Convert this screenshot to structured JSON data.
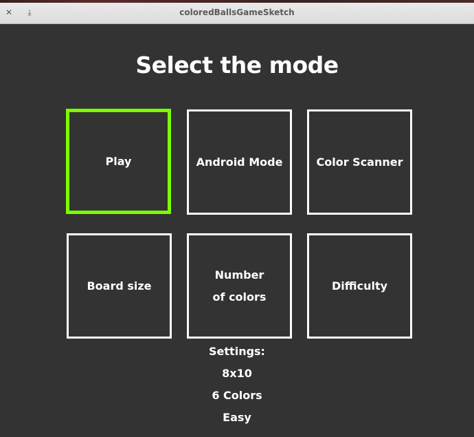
{
  "window": {
    "title": "coloredBallsGameSketch",
    "close_icon": "close-icon",
    "download_icon": "download-icon"
  },
  "heading": "Select the mode",
  "tiles": [
    {
      "label": "Play",
      "selected": true
    },
    {
      "label": "Android Mode",
      "selected": false
    },
    {
      "label": "Color Scanner",
      "selected": false
    },
    {
      "label": "Board size",
      "selected": false
    },
    {
      "label_line1": "Number",
      "label_line2": "of colors",
      "selected": false
    },
    {
      "label": "Difficulty",
      "selected": false
    }
  ],
  "settings": {
    "title": "Settings:",
    "board_size": "8x10",
    "colors": "6 Colors",
    "difficulty": "Easy"
  },
  "colors": {
    "background": "#333333",
    "selected_border": "#7cfc00",
    "border": "#ffffff",
    "text": "#ffffff"
  }
}
